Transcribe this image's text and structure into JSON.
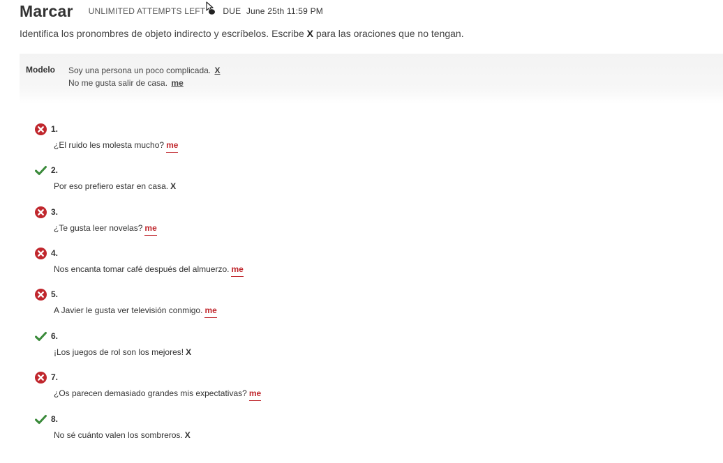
{
  "header": {
    "title": "Marcar",
    "attempts": "UNLIMITED ATTEMPTS LEFT",
    "due_label": "DUE",
    "due_date": "June 25th 11:59 PM"
  },
  "instructions": {
    "before": "Identifica los pronombres de objeto indirecto y escríbelos. Escribe ",
    "bold": "X",
    "after": " para las oraciones que no tengan."
  },
  "modelo": {
    "label": "Modelo",
    "lines": [
      {
        "text": "Soy una persona un poco complicada.",
        "answer": "X"
      },
      {
        "text": "No me gusta salir de casa.",
        "answer": "me"
      }
    ]
  },
  "questions": [
    {
      "number": "1.",
      "text": "¿El ruido les molesta mucho?",
      "answer": "me",
      "status": "incorrect"
    },
    {
      "number": "2.",
      "text": "Por eso prefiero estar en casa.",
      "answer": "X",
      "status": "correct"
    },
    {
      "number": "3.",
      "text": "¿Te gusta leer novelas?",
      "answer": "me",
      "status": "incorrect"
    },
    {
      "number": "4.",
      "text": "Nos encanta tomar café después del almuerzo.",
      "answer": "me",
      "status": "incorrect"
    },
    {
      "number": "5.",
      "text": "A Javier le gusta ver televisión conmigo.",
      "answer": "me",
      "status": "incorrect"
    },
    {
      "number": "6.",
      "text": "¡Los juegos de rol son los mejores!",
      "answer": "X",
      "status": "correct"
    },
    {
      "number": "7.",
      "text": "¿Os parecen demasiado grandes mis expectativas?",
      "answer": "me",
      "status": "incorrect"
    },
    {
      "number": "8.",
      "text": "No sé cuánto valen los sombreros.",
      "answer": "X",
      "status": "correct"
    }
  ],
  "colors": {
    "incorrect": "#c0272d",
    "correct": "#3a8a3a"
  },
  "icons": {
    "incorrect": "x-circle-icon",
    "correct": "checkmark-icon",
    "cursor": "mouse-cursor-icon"
  }
}
